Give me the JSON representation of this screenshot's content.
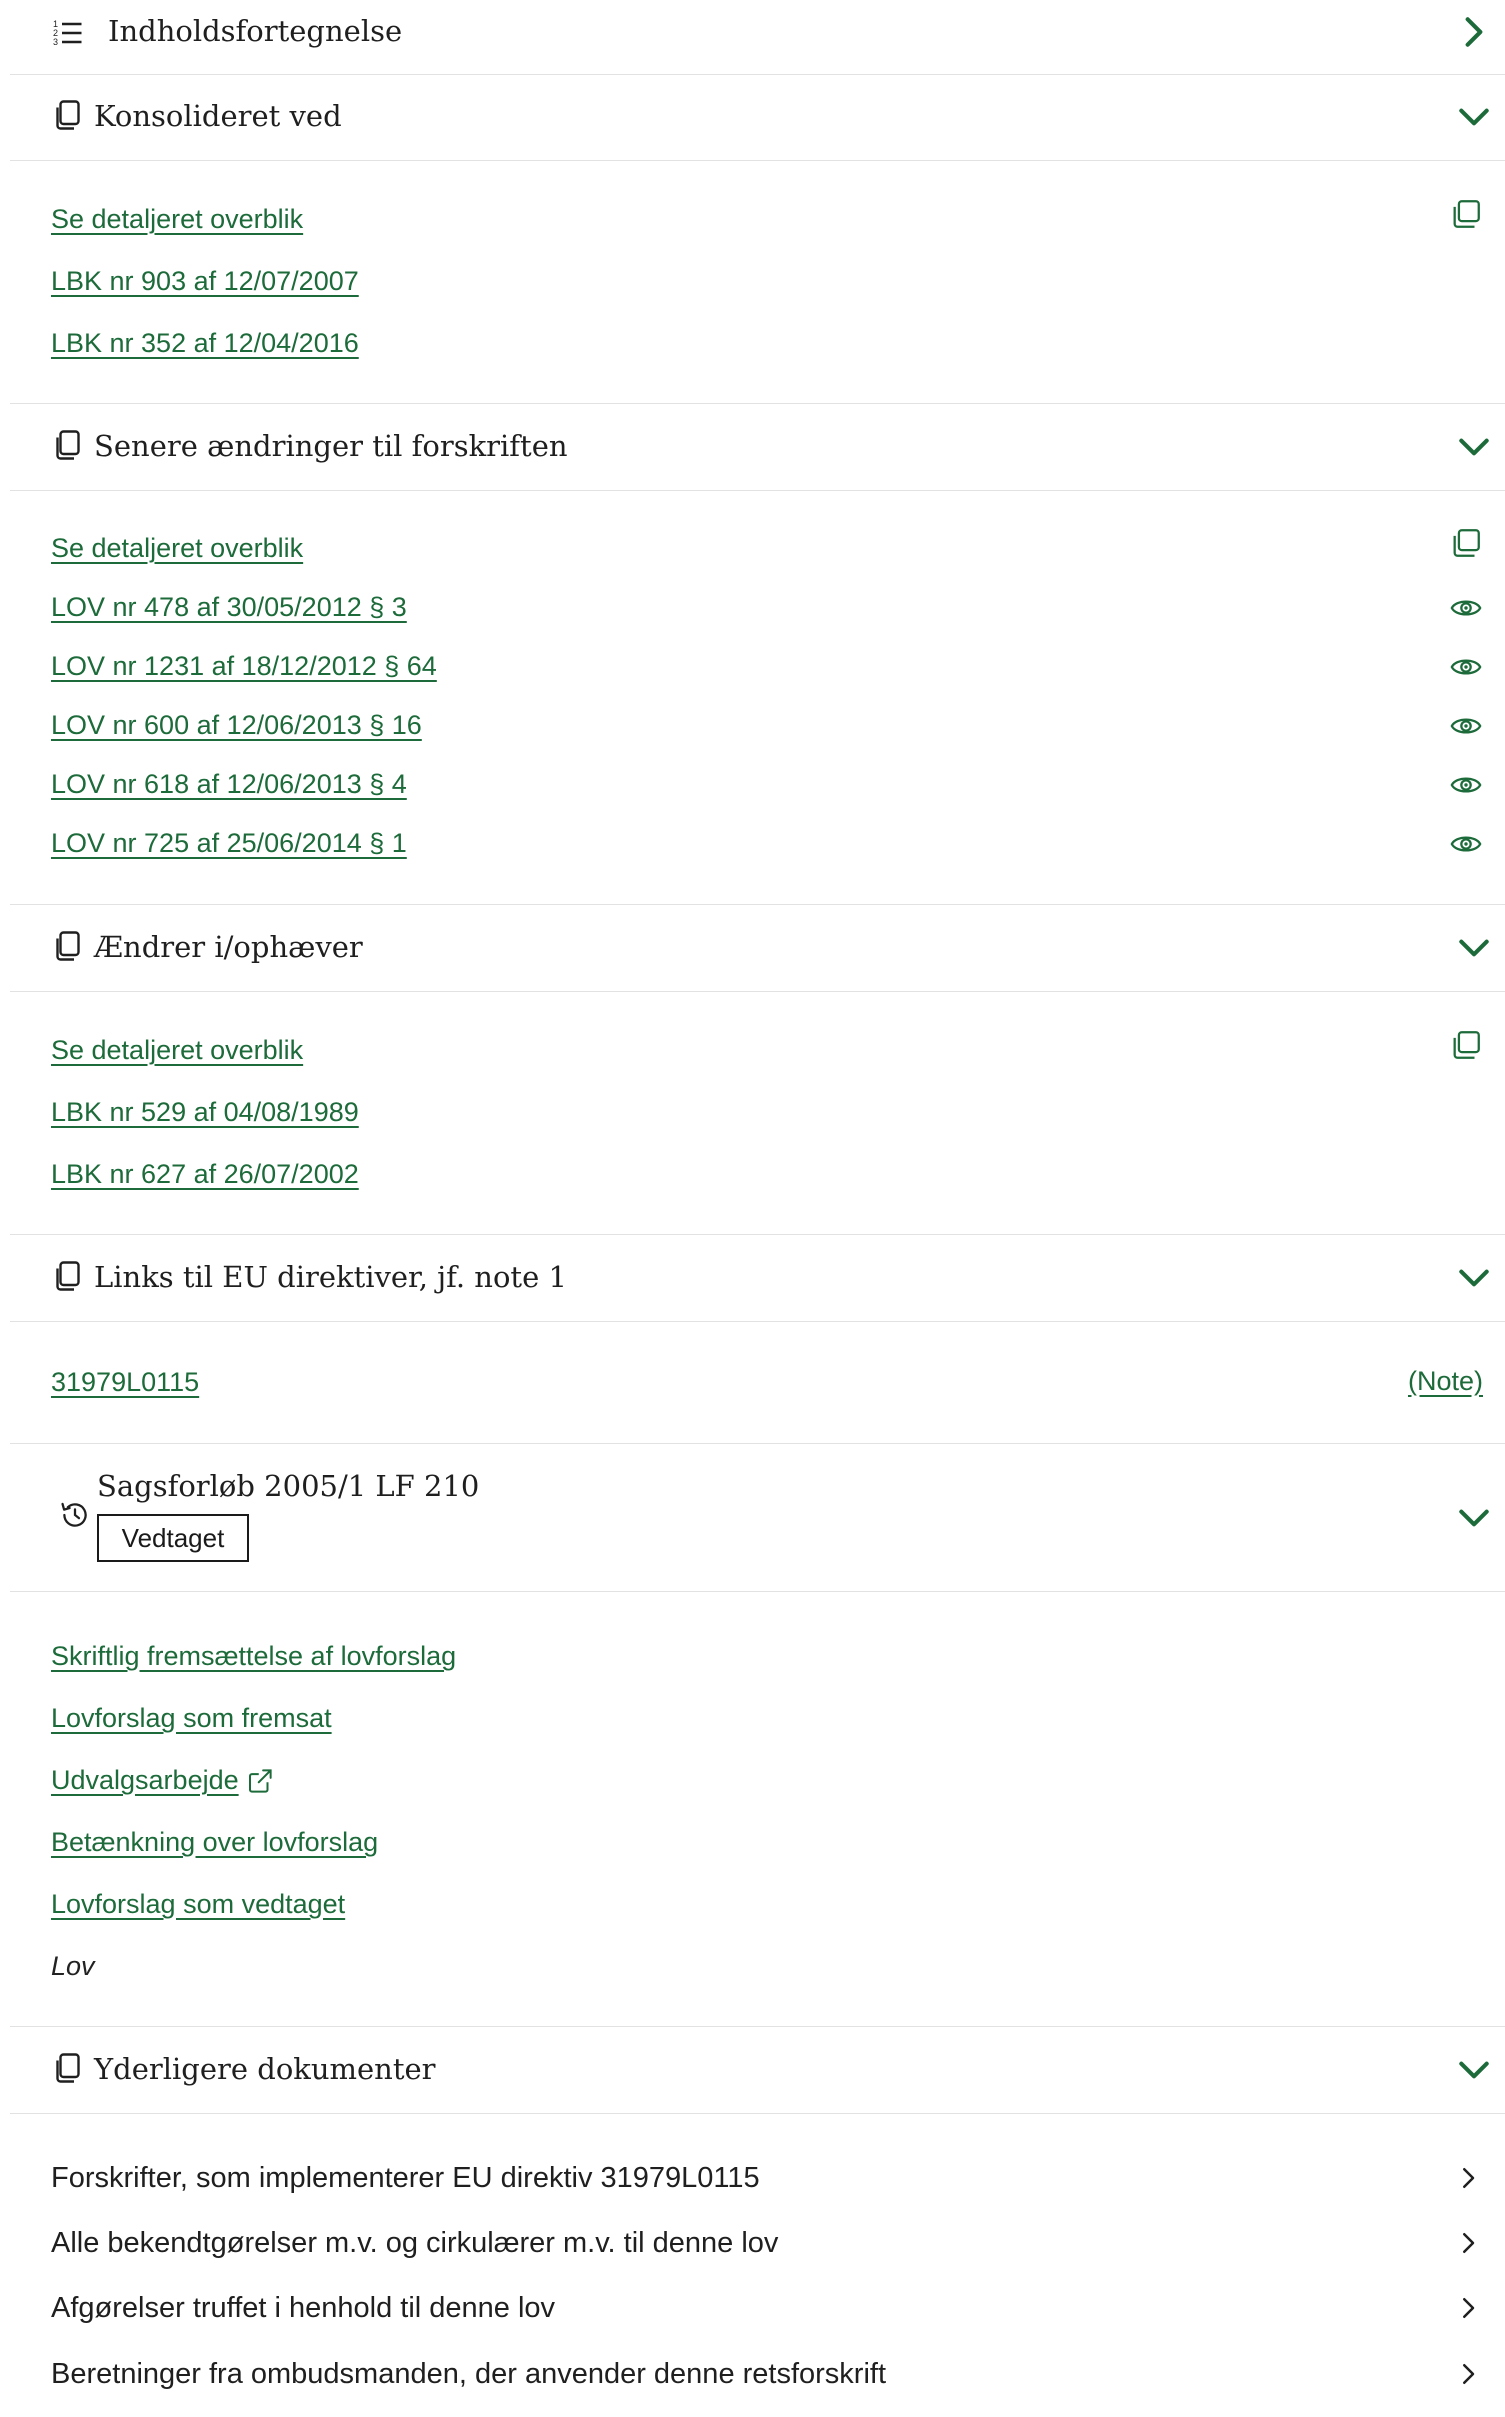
{
  "toc": {
    "title": "Indholdsfortegnelse"
  },
  "consolidated": {
    "title": "Konsolideret ved",
    "overview": "Se detaljeret overblik",
    "links": [
      "LBK nr 903 af 12/07/2007",
      "LBK nr 352 af 12/04/2016"
    ]
  },
  "later_changes": {
    "title": "Senere ændringer til forskriften",
    "overview": "Se detaljeret overblik",
    "links": [
      "LOV nr 478 af 30/05/2012 § 3",
      "LOV nr 1231 af 18/12/2012 § 64",
      "LOV nr 600 af 12/06/2013 § 16",
      "LOV nr 618 af 12/06/2013 § 4",
      "LOV nr 725 af 25/06/2014 § 1"
    ]
  },
  "amends": {
    "title": "Ændrer i/ophæver",
    "overview": "Se detaljeret overblik",
    "links": [
      "LBK nr 529 af 04/08/1989",
      "LBK nr 627 af 26/07/2002"
    ]
  },
  "eu_links": {
    "title": "Links til EU direktiver, jf. note 1",
    "link": "31979L0115",
    "note": "(Note)"
  },
  "case": {
    "title": "Sagsforløb 2005/1 LF 210",
    "status": "Vedtaget",
    "links": [
      "Skriftlig fremsættelse af lovforslag",
      "Lovforslag som fremsat",
      "Udvalgsarbejde",
      "Betænkning over lovforslag",
      "Lovforslag som vedtaget"
    ],
    "final": "Lov"
  },
  "more_docs": {
    "title": "Yderligere dokumenter",
    "items": [
      "Forskrifter, som implementerer EU direktiv 31979L0115",
      "Alle bekendtgørelser m.v. og cirkulærer m.v. til denne lov",
      "Afgørelser truffet i henhold til denne lov",
      "Beretninger fra ombudsmanden, der anvender denne retsforskrift"
    ]
  },
  "colors": {
    "link": "#1d6b3a",
    "chevron": "#1d6b3a",
    "divider": "#e2e2e2"
  },
  "icons": [
    "list-icon",
    "copy-icon",
    "chevron-right-icon",
    "chevron-down-icon",
    "eye-icon",
    "history-icon",
    "external-link-icon"
  ]
}
